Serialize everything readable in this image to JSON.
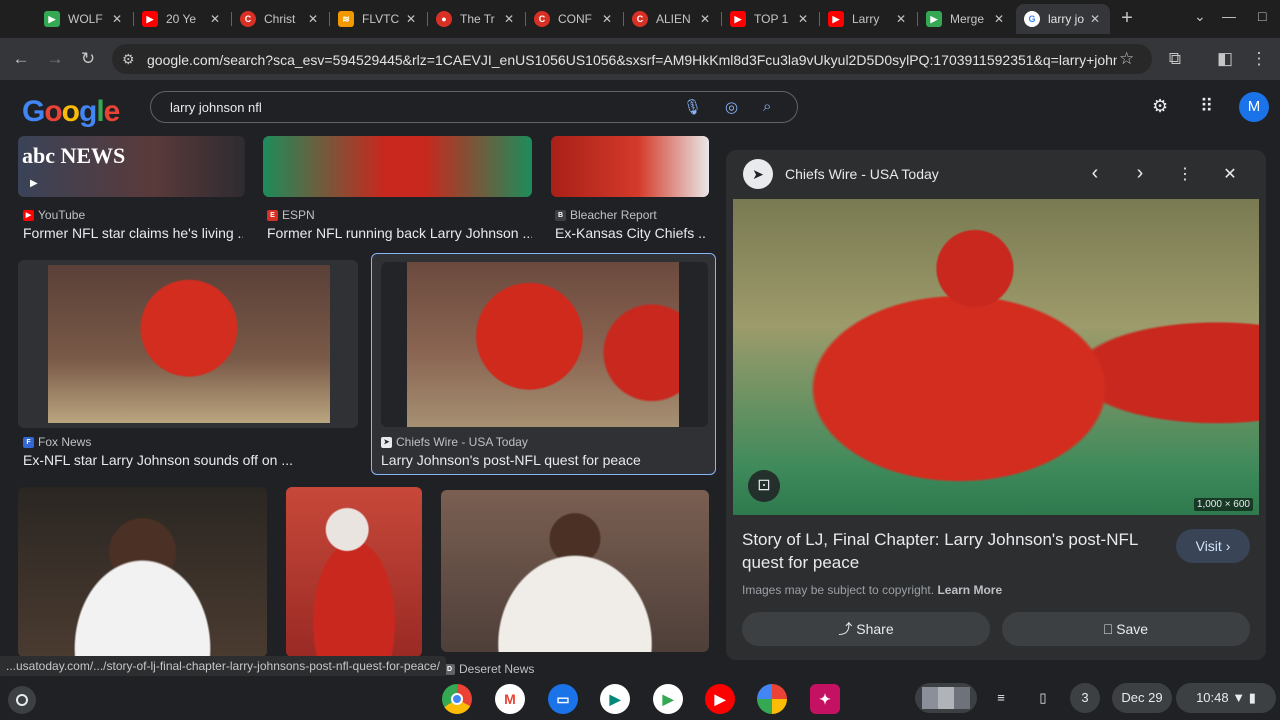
{
  "tabs": [
    {
      "label": "WOLF",
      "icon": "play-icon",
      "color": "#34a853"
    },
    {
      "label": "20 Ye",
      "icon": "youtube-icon",
      "color": "#ff0000"
    },
    {
      "label": "Christ",
      "icon": "c-icon",
      "color": "#d93025"
    },
    {
      "label": "FLVTC",
      "icon": "audio-icon",
      "color": "#f29900"
    },
    {
      "label": "The Tr",
      "icon": "ball-icon",
      "color": "#d93025"
    },
    {
      "label": "CONF",
      "icon": "c-icon",
      "color": "#d93025"
    },
    {
      "label": "ALIEN",
      "icon": "c-icon",
      "color": "#d93025"
    },
    {
      "label": "TOP 1",
      "icon": "youtube-icon",
      "color": "#ff0000"
    },
    {
      "label": "Larry",
      "icon": "youtube-icon",
      "color": "#ff0000"
    },
    {
      "label": "Merge",
      "icon": "play-icon",
      "color": "#34a853"
    },
    {
      "label": "larry jo",
      "icon": "google-icon",
      "color": "#4285f4"
    }
  ],
  "address_bar": {
    "url": "google.com/search?sca_esv=594529445&rlz=1CAEVJI_enUS1056US1056&sxsrf=AM9HkKml8d3Fcu3la9vUkyul2D5D0sylPQ:1703911592351&q=larry+johnson+nfl..."
  },
  "search": {
    "query": "larry johnson nfl",
    "avatar_letter": "M"
  },
  "logo": {
    "letters": [
      "G",
      "o",
      "o",
      "g",
      "l",
      "e"
    ],
    "colors": [
      "#4285f4",
      "#ea4335",
      "#fbbc05",
      "#4285f4",
      "#34a853",
      "#ea4335"
    ]
  },
  "results": [
    {
      "source": "YouTube",
      "title": "Former NFL star claims he's living ...",
      "badge": "abc NEWS"
    },
    {
      "source": "ESPN",
      "title": "Former NFL running back Larry Johnson ..."
    },
    {
      "source": "Bleacher Report",
      "title": "Ex-Kansas City Chiefs ..."
    },
    {
      "source": "Fox News",
      "title": "Ex-NFL star Larry Johnson sounds off on ..."
    },
    {
      "source": "Chiefs Wire - USA Today",
      "title": "Larry Johnson's post-NFL quest for peace"
    },
    {
      "source": "Deseret News",
      "title": ""
    }
  ],
  "status_url": "...usatoday.com/.../story-of-lj-final-chapter-larry-johnsons-post-nfl-quest-for-peace/",
  "panel": {
    "source": "Chiefs Wire - USA Today",
    "dimensions": "1,000 × 600",
    "title": "Story of LJ, Final Chapter: Larry Johnson's post-NFL quest for peace",
    "visit_label": "Visit",
    "copyright_text": "Images may be subject to copyright.",
    "learn_more": "Learn More",
    "share_label": "Share",
    "save_label": "Save"
  },
  "shelf": {
    "apps": [
      "chrome",
      "gmail",
      "messages",
      "meet",
      "play-store",
      "youtube",
      "photos",
      "gallery"
    ],
    "notification_count": "3",
    "date": "Dec 29",
    "time": "10:48"
  }
}
